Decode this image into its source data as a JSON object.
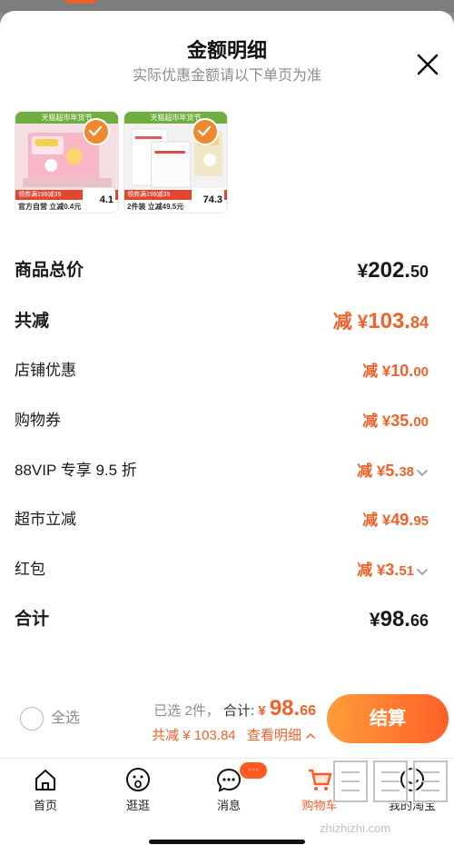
{
  "header": {
    "title": "金额明细",
    "subtitle": "实际优惠金额请以下单页为准"
  },
  "products": [
    {
      "banner": "天猫超市年货节",
      "strip": "领券满199减35",
      "foot": "官方自营 立减0.4元",
      "price": "4.1",
      "checked": true
    },
    {
      "banner": "天猫超市年货节",
      "strip": "领券满199减35",
      "foot": "2件装 立减49.5元",
      "price": "74.3",
      "checked": true
    }
  ],
  "rows": {
    "subtotal": {
      "label": "商品总价",
      "prefix": "¥",
      "int": "202.",
      "dec": "50"
    },
    "total_reduce": {
      "label": "共减",
      "prefix": "减 ¥",
      "int": "103.",
      "dec": "84"
    },
    "store_discount": {
      "label": "店铺优惠",
      "prefix": "减 ¥",
      "int": "10.",
      "dec": "00"
    },
    "coupon": {
      "label": "购物券",
      "prefix": "减 ¥",
      "int": "35.",
      "dec": "00"
    },
    "vip": {
      "label": "88VIP 专享 9.5 折",
      "prefix": "减 ¥",
      "int": "5.",
      "dec": "38"
    },
    "market": {
      "label": "超市立减",
      "prefix": "减 ¥",
      "int": "49.",
      "dec": "95"
    },
    "redpacket": {
      "label": "红包",
      "prefix": "减 ¥",
      "int": "3.",
      "dec": "51"
    },
    "grand_total": {
      "label": "合计",
      "prefix": "¥",
      "int": "98.",
      "dec": "66"
    }
  },
  "bottombar": {
    "select_all": "全选",
    "selected_count": "已选 2件，",
    "total_label": "合计:",
    "total_prefix": "¥ ",
    "total_int": "98.",
    "total_dec": "66",
    "reduce_text": "共减 ¥ 103.84",
    "view_detail": "查看明细",
    "checkout": "结算"
  },
  "tabbar": {
    "home": "首页",
    "browse": "逛逛",
    "messages": "消息",
    "messages_badge": "···",
    "cart": "购物车",
    "mine": "我的淘宝"
  },
  "watermark": "zhizhizhi.com",
  "colors": {
    "accent": "#f0622a",
    "checkout_start": "#ff9d3a",
    "checkout_end": "#ff5f28"
  }
}
